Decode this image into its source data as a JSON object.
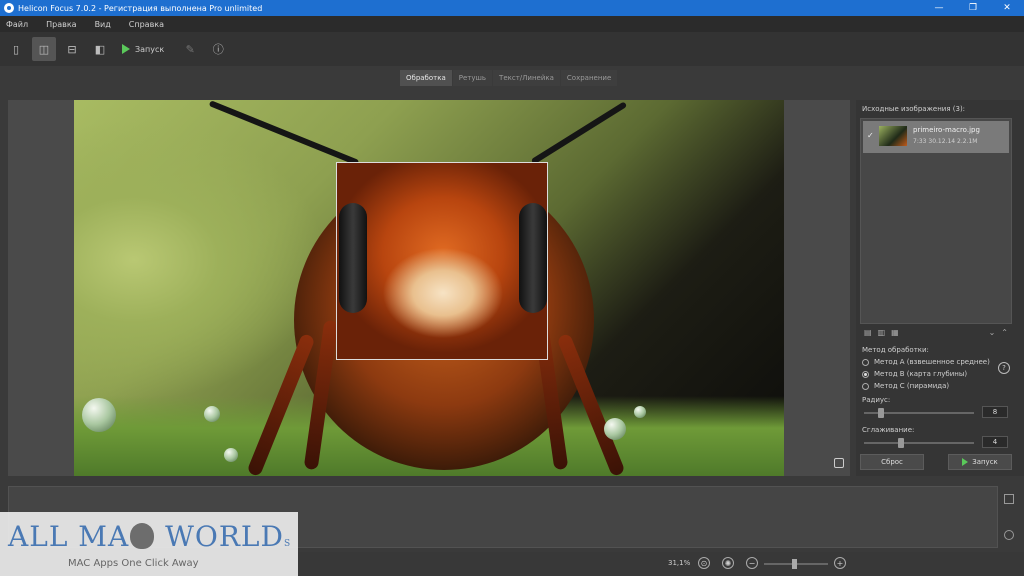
{
  "window": {
    "title": "Helicon Focus 7.0.2 - Регистрация выполнена Pro unlimited",
    "minimize": "—",
    "maximize": "❐",
    "close": "✕"
  },
  "menu": [
    "Файл",
    "Правка",
    "Вид",
    "Справка"
  ],
  "toolbar": {
    "run_label": "Запуск"
  },
  "tabs": [
    {
      "label": "Обработка",
      "active": true
    },
    {
      "label": "Ретушь",
      "active": false
    },
    {
      "label": "Текст/Линейка",
      "active": false
    },
    {
      "label": "Сохранение",
      "active": false
    }
  ],
  "right_panel": {
    "source_title": "Исходные изображения (3):",
    "item": {
      "check": "✓",
      "name": "primeiro-macro.jpg",
      "meta": "7:33 30.12.14 2.2.1M"
    },
    "method_title": "Метод обработки:",
    "methods": [
      {
        "label": "Метод A (взвешенное среднее)",
        "selected": false
      },
      {
        "label": "Метод B (карта глубины)",
        "selected": true
      },
      {
        "label": "Метод C (пирамида)",
        "selected": false
      }
    ],
    "help": "?",
    "radius_label": "Радиус:",
    "radius_value": "8",
    "smoothing_label": "Сглаживание:",
    "smoothing_value": "4",
    "reset_label": "Сброс",
    "run_label": "Запуск"
  },
  "statusbar": {
    "zoom": "31,1%"
  },
  "watermark": {
    "brand_left": "ALL MA",
    "brand_right": " WORLD",
    "brand_s": "S",
    "tagline": "MAC Apps One Click Away"
  }
}
